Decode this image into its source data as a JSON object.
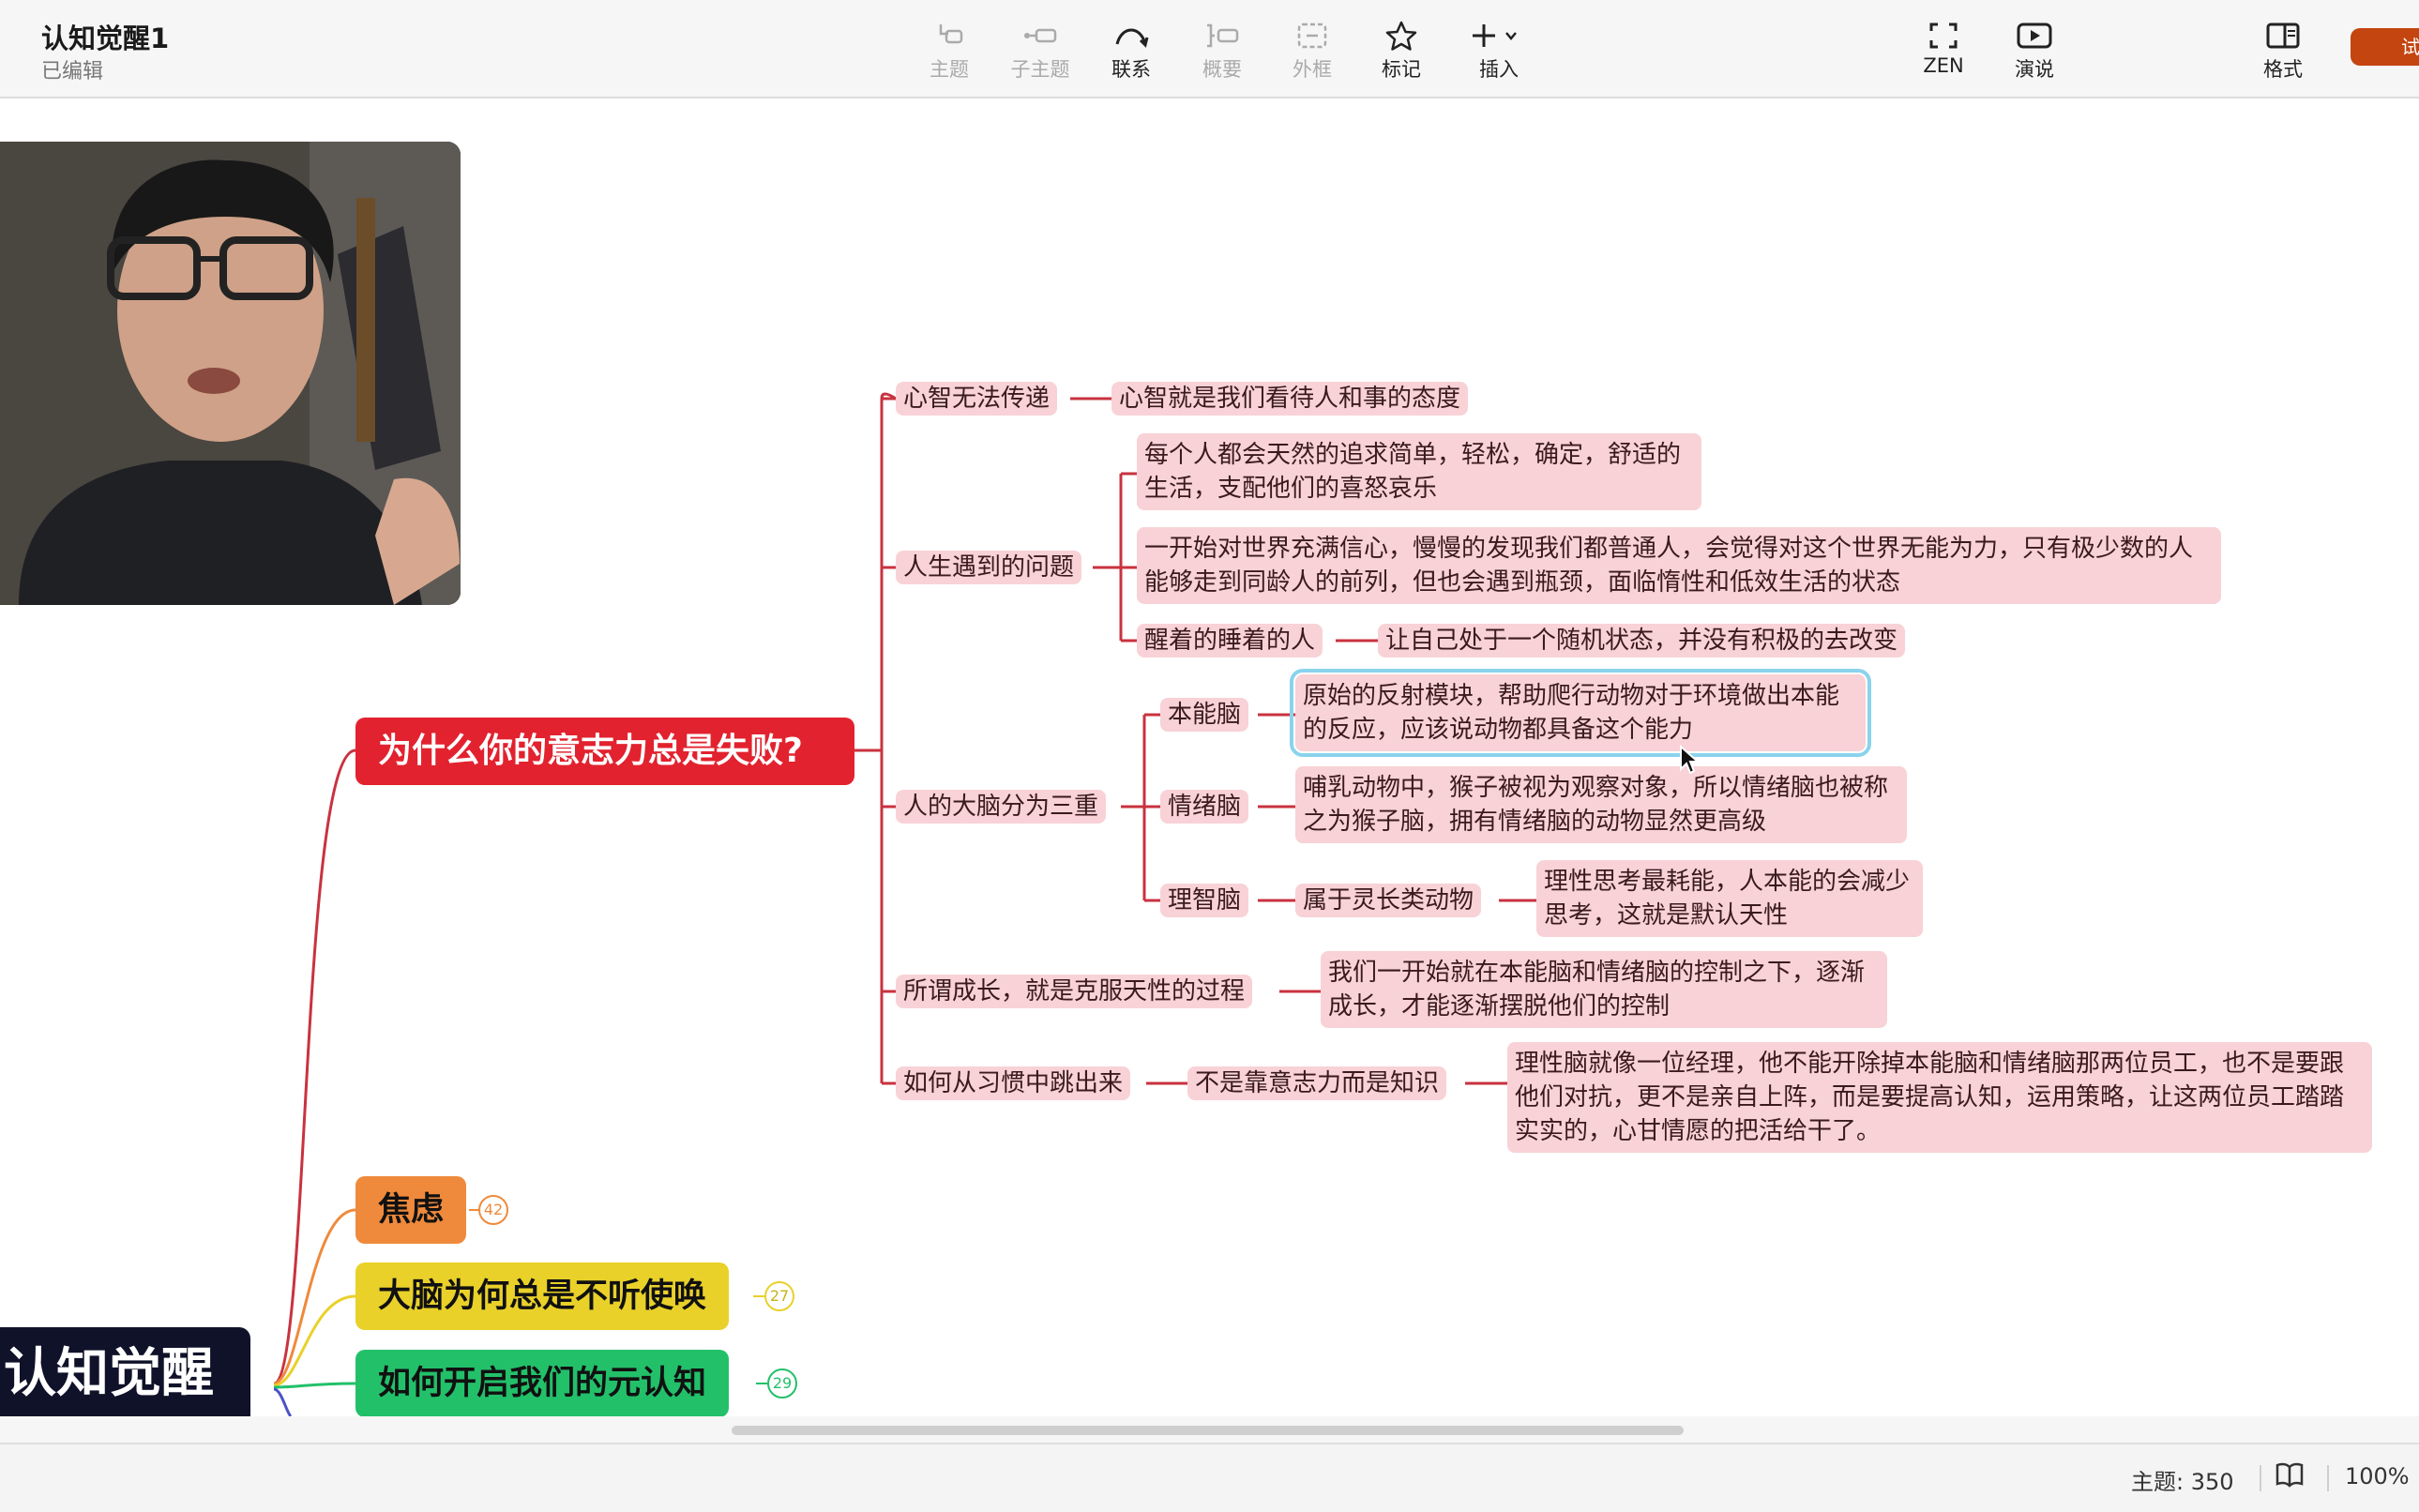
{
  "header": {
    "title": "认知觉醒1",
    "subtitle": "已编辑"
  },
  "toolbar": {
    "topic": "主题",
    "subtopic": "子主题",
    "relation": "联系",
    "summary": "概要",
    "boundary": "外框",
    "marker": "标记",
    "insert": "插入",
    "zen": "ZEN",
    "present": "演说",
    "format": "格式",
    "trial": "试"
  },
  "mindmap": {
    "central_topic": "认知觉醒",
    "main_topic": "为什么你的意志力总是失败?",
    "nodes": {
      "n1": "心智无法传递",
      "n1a": "心智就是我们看待人和事的态度",
      "n2": "人生遇到的问题",
      "n2a": "每个人都会天然的追求简单，轻松，确定，舒适的生活，支配他们的喜怒哀乐",
      "n2b": "一开始对世界充满信心，慢慢的发现我们都普通人，会觉得对这个世界无能为力，只有极少数的人能够走到同龄人的前列，但也会遇到瓶颈，面临惰性和低效生活的状态",
      "n2c": "醒着的睡着的人",
      "n2c1": "让自己处于一个随机状态，并没有积极的去改变",
      "n3": "人的大脑分为三重",
      "n3a": "本能脑",
      "n3a1": "原始的反射模块，帮助爬行动物对于环境做出本能的反应，应该说动物都具备这个能力",
      "n3b": "情绪脑",
      "n3b1": "哺乳动物中，猴子被视为观察对象，所以情绪脑也被称之为猴子脑，拥有情绪脑的动物显然更高级",
      "n3c": "理智脑",
      "n3c1": "属于灵长类动物",
      "n3c2": "理性思考最耗能，人本能的会减少思考，这就是默认天性",
      "n4": "所谓成长，就是克服天性的过程",
      "n4a": "我们一开始就在本能脑和情绪脑的控制之下，逐渐成长，才能逐渐摆脱他们的控制",
      "n5": "如何从习惯中跳出来",
      "n5a": "不是靠意志力而是知识",
      "n5a1": "理性脑就像一位经理，他不能开除掉本能脑和情绪脑那两位员工，也不是要跟他们对抗，更不是亲自上阵，而是要提高认知，运用策略，让这两位员工踏踏实实的，心甘情愿的把活给干了。"
    },
    "branches": [
      {
        "label": "焦虑",
        "count": "42",
        "color": "#ef8a3c"
      },
      {
        "label": "大脑为何总是不听使唤",
        "count": "27",
        "color": "#e9d12a"
      },
      {
        "label": "如何开启我们的元认知",
        "count": "29",
        "color": "#23c06a"
      }
    ],
    "line_color": "#c9323f"
  },
  "status": {
    "topics": "主题: 350",
    "zoom": "100%"
  }
}
